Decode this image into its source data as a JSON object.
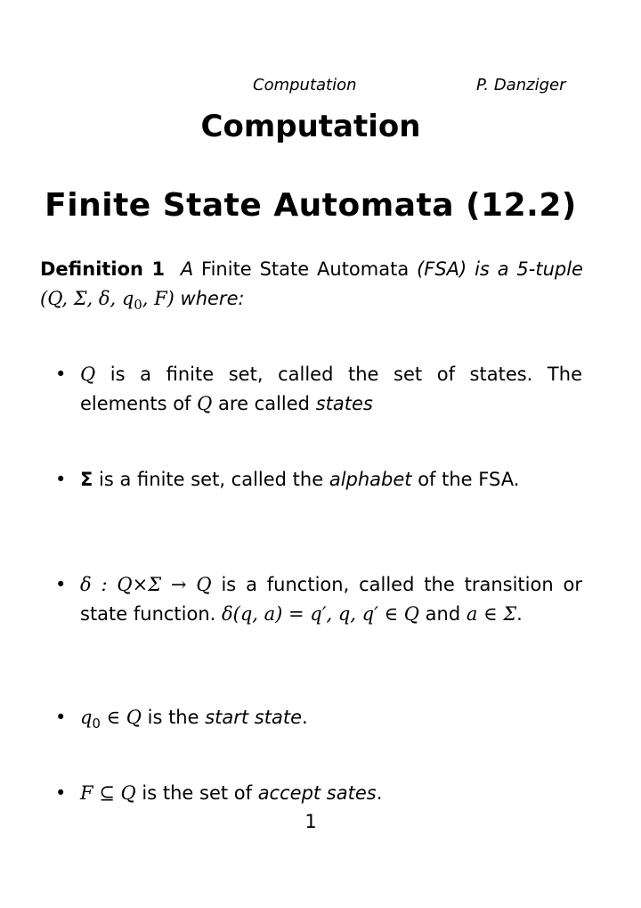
{
  "header": {
    "left": "Computation",
    "right": "P. Danziger"
  },
  "title": "Computation",
  "section_title": "Finite State Automata (12.2)",
  "definition": {
    "label": "Definition 1",
    "text_a": "A",
    "text_term": "Finite State Automata",
    "text_b": "(FSA) is a 5-tuple",
    "tuple": "(Q, Σ, δ, q",
    "tuple_sub": "0",
    "tuple_end": ", F)",
    "text_c": "where:"
  },
  "bullets": [
    {
      "math": "Q",
      "text": " is a finite set, called the set of states. The elements of ",
      "math2": "Q",
      "text2": " are called ",
      "emph": "states",
      "end": ""
    },
    {
      "math": "Σ",
      "text": " is a finite set, called the ",
      "emph": "alphabet",
      "end": " of the FSA."
    },
    {
      "math": "δ : Q×Σ → Q",
      "text": " is a function, called the transition or state function.  ",
      "math2": "δ(q, a) = q′,  q, q′ ∈ Q",
      "text2": " and ",
      "math3": "a ∈ Σ",
      "end": "."
    },
    {
      "math": "q",
      "math_sub": "0",
      "math_rest": " ∈ Q",
      "text": " is the ",
      "emph": "start state",
      "end": "."
    },
    {
      "math": "F ⊆ Q",
      "text": " is the set of ",
      "emph": "accept sates",
      "end": "."
    }
  ],
  "page_number": "1"
}
